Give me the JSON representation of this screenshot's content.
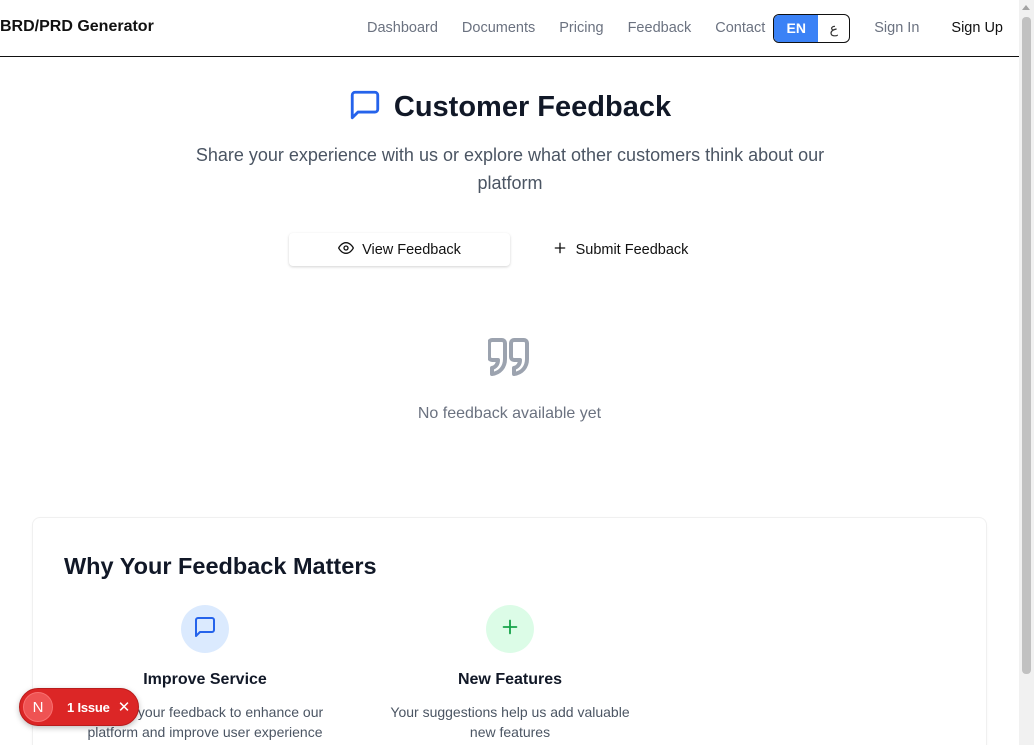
{
  "header": {
    "brand": "BRD/PRD Generator",
    "nav": [
      "Dashboard",
      "Documents",
      "Pricing",
      "Feedback",
      "Contact"
    ],
    "lang_en": "EN",
    "lang_ar": "ع",
    "sign_in": "Sign In",
    "sign_up": "Sign Up"
  },
  "hero": {
    "title": "Customer Feedback",
    "subtitle": "Share your experience with us or explore what other customers think about our platform",
    "tab_view": "View Feedback",
    "tab_submit": "Submit Feedback",
    "empty_text": "No feedback available yet"
  },
  "why": {
    "title": "Why Your Feedback Matters",
    "features": [
      {
        "title": "Improve Service",
        "desc": "We use your feedback to enhance our platform and improve user experience",
        "icon": "message-square-icon",
        "color": "#dbeafe"
      },
      {
        "title": "New Features",
        "desc": "Your suggestions help us add valuable new features",
        "icon": "plus-icon",
        "color": "#dcfce7"
      }
    ]
  },
  "issue_badge": {
    "letter": "N",
    "label": "1 Issue"
  },
  "colors": {
    "accent": "#3b82f6",
    "issue": "#dc2626"
  }
}
